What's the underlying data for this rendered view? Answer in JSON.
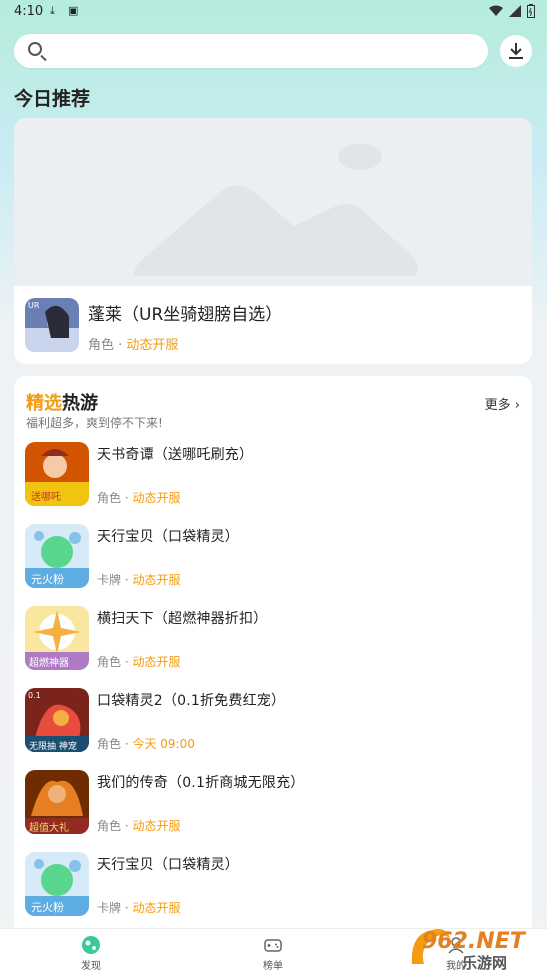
{
  "status": {
    "time": "4:10"
  },
  "search": {
    "placeholder": ""
  },
  "featured": {
    "section_title": "今日推荐",
    "game": {
      "name": "蓬莱（UR坐骑翅膀自选）",
      "genre": "角色",
      "server": "动态开服"
    }
  },
  "hot": {
    "title_accent": "精选",
    "title_rest": "热游",
    "subtitle": "福利超多，爽到停不下来!",
    "more_label": "更多",
    "items": [
      {
        "name": "天书奇谭（送哪吒刷充）",
        "genre": "角色",
        "server": "动态开服",
        "icon_color": "#d35400"
      },
      {
        "name": "天行宝贝（口袋精灵）",
        "genre": "卡牌",
        "server": "动态开服",
        "icon_color": "#5dade2"
      },
      {
        "name": "横扫天下（超燃神器折扣）",
        "genre": "角色",
        "server": "动态开服",
        "icon_color": "#f4d03f"
      },
      {
        "name": "口袋精灵2（0.1折免费红宠）",
        "genre": "角色",
        "server": "今天 09:00",
        "icon_color": "#c0392b"
      },
      {
        "name": "我们的传奇（0.1折商城无限充）",
        "genre": "角色",
        "server": "动态开服",
        "icon_color": "#e67e22"
      },
      {
        "name": "天行宝贝（口袋精灵）",
        "genre": "卡牌",
        "server": "动态开服",
        "icon_color": "#5dade2"
      }
    ]
  },
  "tabs": [
    {
      "label": "发现"
    },
    {
      "label": "榜单"
    },
    {
      "label": "我的"
    }
  ],
  "watermark": {
    "text_top": "962.NET",
    "text_bottom": "乐游网"
  },
  "colors": {
    "accent": "#f39c12",
    "brand": "#3cc79a"
  }
}
